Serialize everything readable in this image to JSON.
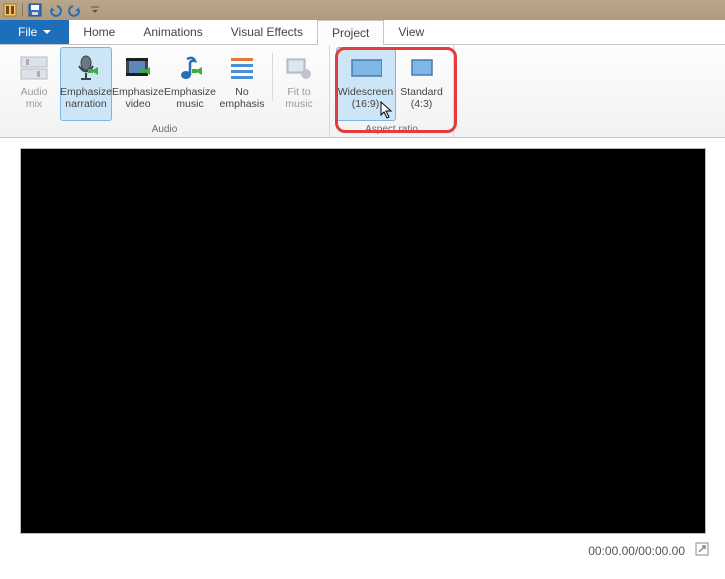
{
  "qat": {
    "app_icon": "app-icon",
    "save_icon": "save-icon",
    "undo_icon": "undo-icon",
    "redo_icon": "redo-icon",
    "customize_icon": "customize-icon"
  },
  "tabs": {
    "file": "File",
    "home": "Home",
    "animations": "Animations",
    "visual_effects": "Visual Effects",
    "project": "Project",
    "view": "View"
  },
  "ribbon": {
    "groups": {
      "audio": {
        "label": "Audio",
        "audio_mix": {
          "line1": "Audio",
          "line2": "mix"
        },
        "emphasize_narration": {
          "line1": "Emphasize",
          "line2": "narration"
        },
        "emphasize_video": {
          "line1": "Emphasize",
          "line2": "video"
        },
        "emphasize_music": {
          "line1": "Emphasize",
          "line2": "music"
        },
        "no_emphasis": {
          "line1": "No",
          "line2": "emphasis"
        },
        "fit_to_music": {
          "line1": "Fit to",
          "line2": "music"
        }
      },
      "aspect": {
        "label": "Aspect ratio",
        "widescreen": {
          "line1": "Widescreen",
          "line2": "(16:9)"
        },
        "standard": {
          "line1": "Standard",
          "line2": "(4:3)"
        }
      }
    }
  },
  "status": {
    "time": "00:00.00/00:00.00"
  },
  "colors": {
    "file_tab": "#1d6fbb",
    "highlight": "#e63b3b",
    "selected_bg": "#cde6f7",
    "selected_border": "#7eb4e0"
  }
}
